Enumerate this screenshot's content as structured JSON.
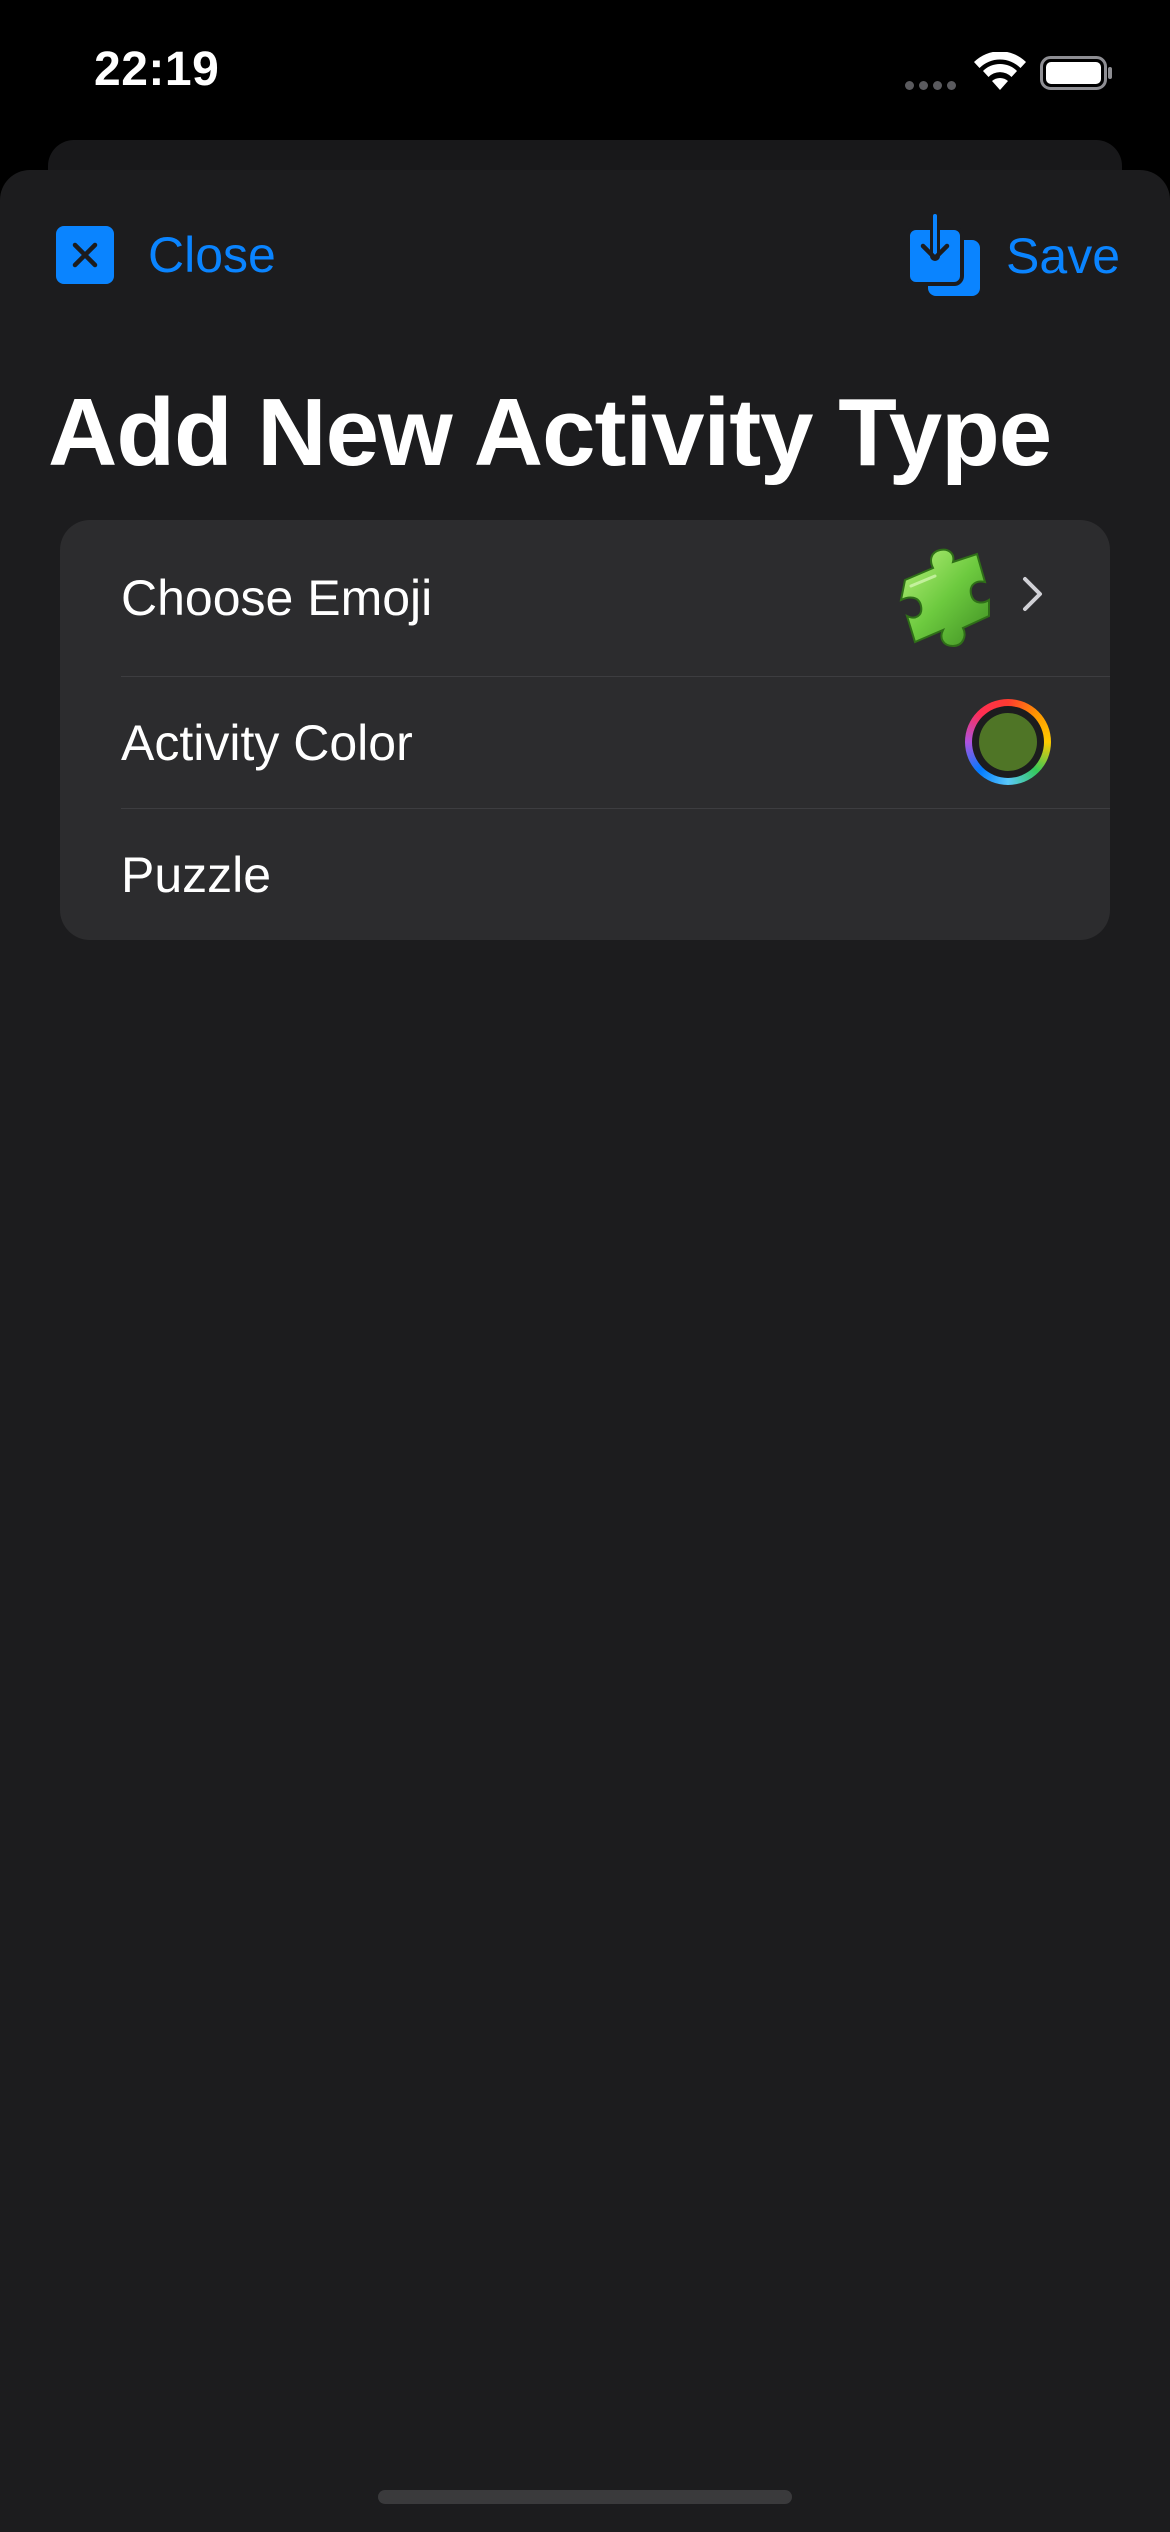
{
  "status_bar": {
    "time": "22:19"
  },
  "nav": {
    "close_label": "Close",
    "save_label": "Save",
    "close_icon": "xmark-square-icon",
    "save_icon": "square-and-arrow-down-on-square-icon"
  },
  "page": {
    "title": "Add New Activity Type"
  },
  "form": {
    "rows": [
      {
        "label": "Choose Emoji",
        "value_icon": "puzzle-piece-emoji",
        "accessory": "chevron-right-icon"
      },
      {
        "label": "Activity Color",
        "value_color": "#4f7526"
      },
      {
        "label": "Puzzle"
      }
    ]
  },
  "colors": {
    "accent": "#0a84ff",
    "background": "#1c1c1e",
    "group_background": "#2c2c2e",
    "text": "#ffffff"
  }
}
